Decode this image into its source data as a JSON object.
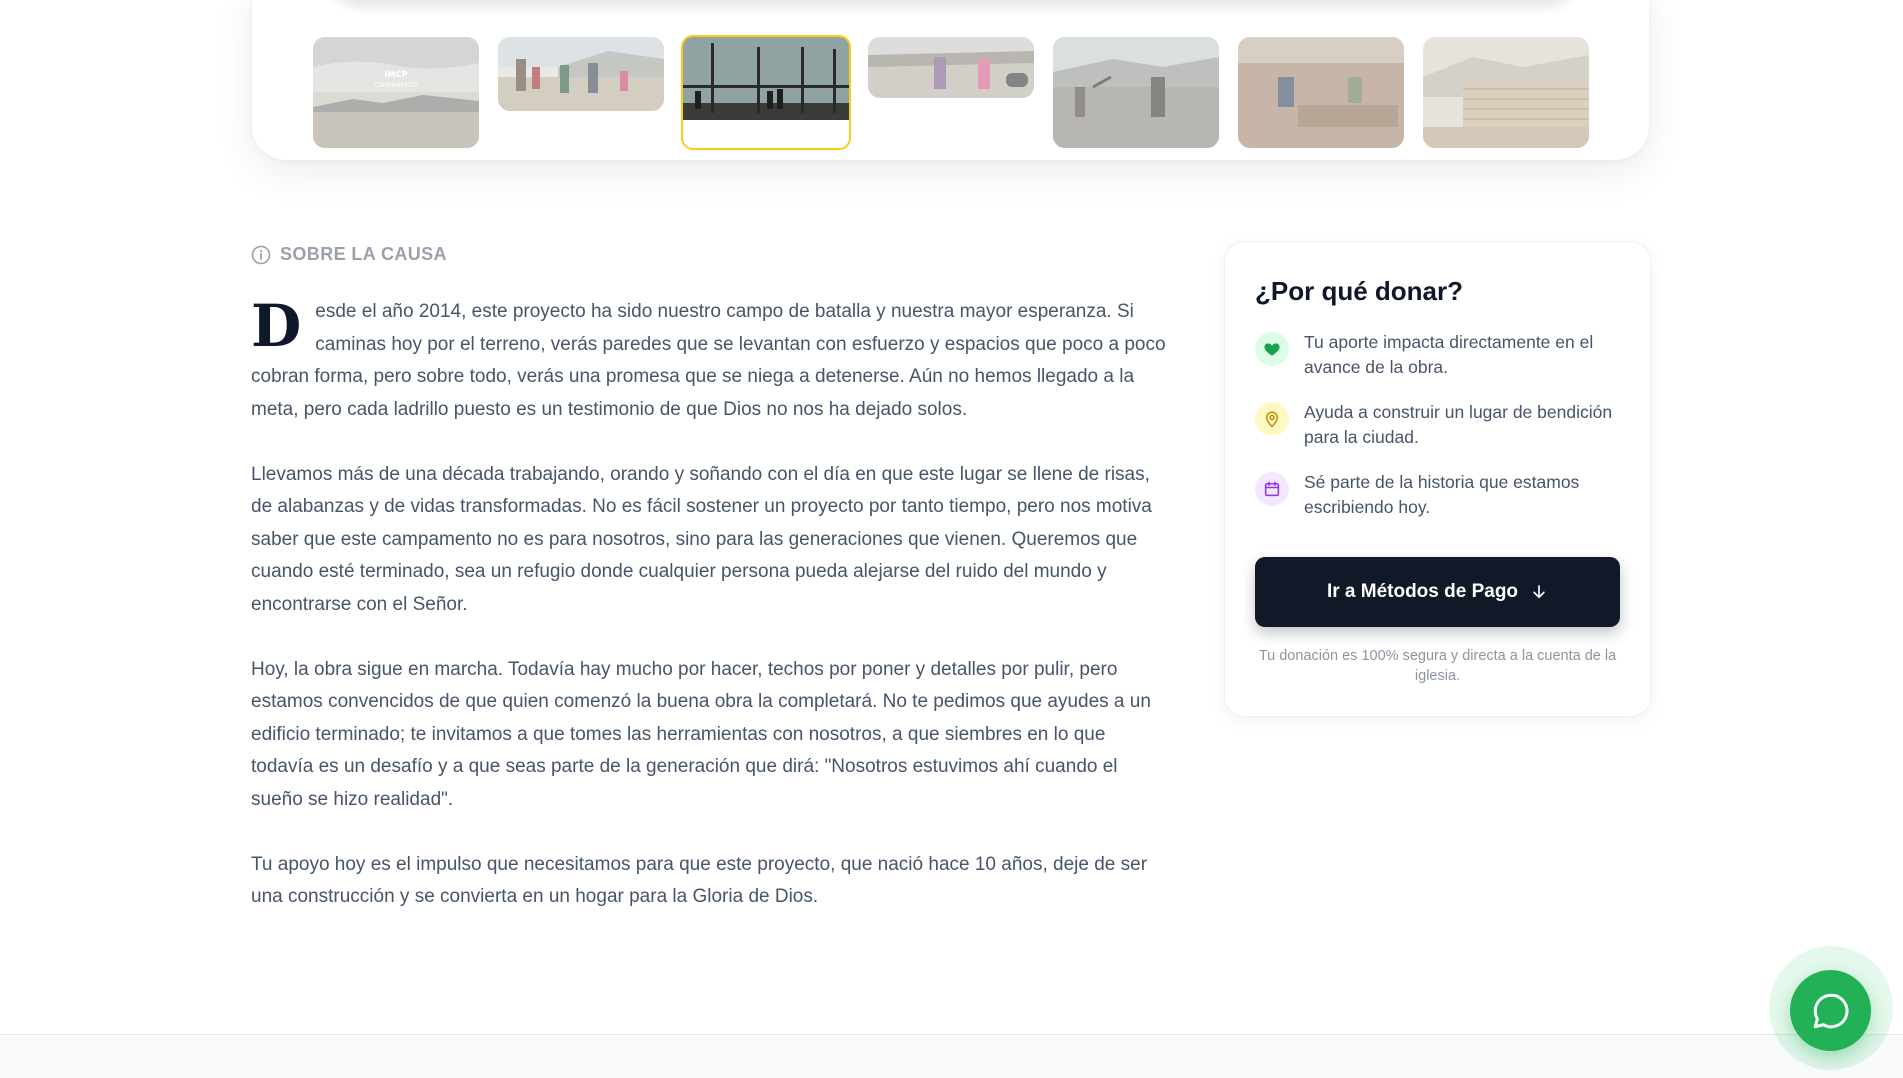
{
  "gallery": {
    "thumbnails": [
      {
        "alt": "campamento-cover",
        "overlay_title": "IMCP",
        "overlay_subtitle": "CAMPAMENTO",
        "active": false
      },
      {
        "alt": "group-on-terrain",
        "active": false
      },
      {
        "alt": "structure-frame",
        "active": true
      },
      {
        "alt": "children-on-site",
        "active": false
      },
      {
        "alt": "digging-with-pickaxes",
        "active": false
      },
      {
        "alt": "laying-bricks",
        "active": false
      },
      {
        "alt": "brick-walls",
        "active": false
      }
    ],
    "active_border_color": "#facc15"
  },
  "about": {
    "label": "SOBRE LA CAUSA",
    "drop_cap": "D",
    "paragraph_1_rest": "esde el año 2014, este proyecto ha sido nuestro campo de batalla y nuestra mayor esperanza. Si caminas hoy por el terreno, verás paredes que se levantan con esfuerzo y espacios que poco a poco cobran forma, pero sobre todo, verás una promesa que se niega a detenerse. Aún no hemos llegado a la meta, pero cada ladrillo puesto es un testimonio de que Dios no nos ha dejado solos.",
    "paragraph_2": "Llevamos más de una década trabajando, orando y soñando con el día en que este lugar se llene de risas, de alabanzas y de vidas transformadas. No es fácil sostener un proyecto por tanto tiempo, pero nos motiva saber que este campamento no es para nosotros, sino para las generaciones que vienen. Queremos que cuando esté terminado, sea un refugio donde cualquier persona pueda alejarse del ruido del mundo y encontrarse con el Señor.",
    "paragraph_3": "Hoy, la obra sigue en marcha. Todavía hay mucho por hacer, techos por poner y detalles por pulir, pero estamos convencidos de que quien comenzó la buena obra la completará. No te pedimos que ayudes a un edificio terminado; te invitamos a que tomes las herramientas con nosotros, a que siembres en lo que todavía es un desafío y a que seas parte de la generación que dirá: \"Nosotros estuvimos ahí cuando el sueño se hizo realidad\".",
    "paragraph_4": "Tu apoyo hoy es el impulso que necesitamos para que este proyecto, que nació hace 10 años, deje de ser una construcción y se convierta en un hogar para la Gloria de Dios."
  },
  "donate": {
    "title": "¿Por qué donar?",
    "reasons": [
      {
        "icon": "heart-icon",
        "text": "Tu aporte impacta directamente en el avance de la obra.",
        "color": "#16a34a",
        "bg": "#dcfce7"
      },
      {
        "icon": "map-pin-icon",
        "text": "Ayuda a construir un lugar de bendición para la ciudad.",
        "color": "#ca8a04",
        "bg": "#fef9c3"
      },
      {
        "icon": "calendar-icon",
        "text": "Sé parte de la historia que estamos escribiendo hoy.",
        "color": "#9333ea",
        "bg": "#f3e8ff"
      }
    ],
    "button_label": "Ir a Métodos de Pago",
    "button_icon": "arrow-down-icon",
    "secure_note": "Tu donación es 100% segura y directa a la cuenta de la iglesia."
  },
  "whatsapp": {
    "icon": "whatsapp-chat-icon",
    "color": "#22b157"
  }
}
